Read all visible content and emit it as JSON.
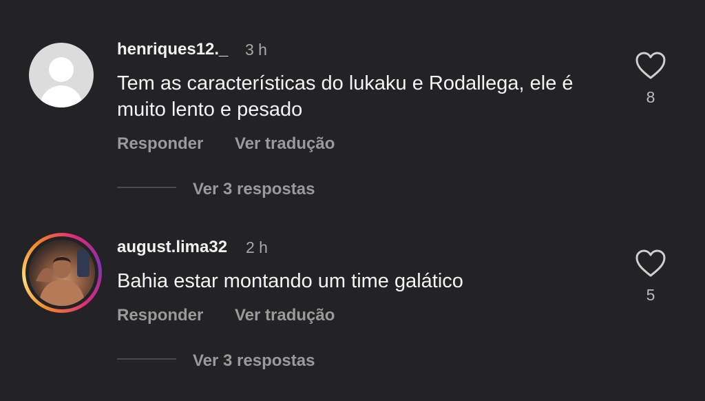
{
  "comments": [
    {
      "username": "henriques12._",
      "time": "3 h",
      "text": "Tem as características do lukaku e Rodallega, ele é muito lento e pesado",
      "reply_label": "Responder",
      "translate_label": "Ver tradução",
      "view_replies_label": "Ver 3 respostas",
      "likes": "8",
      "avatar": "default-avatar-icon"
    },
    {
      "username": "august.lima32",
      "time": "2 h",
      "text": "Bahia estar montando um time galático",
      "reply_label": "Responder",
      "translate_label": "Ver tradução",
      "view_replies_label": "Ver 3 respostas",
      "likes": "5",
      "avatar": "photo-with-story-ring"
    }
  ],
  "colors": {
    "background": "#232325",
    "primary_text": "#f2f2f2",
    "secondary_text": "#9a9a9a",
    "story_ring": [
      "#f58529",
      "#feda77",
      "#dd2a7b",
      "#8134af"
    ]
  },
  "icons": {
    "like": "heart-outline-icon"
  }
}
